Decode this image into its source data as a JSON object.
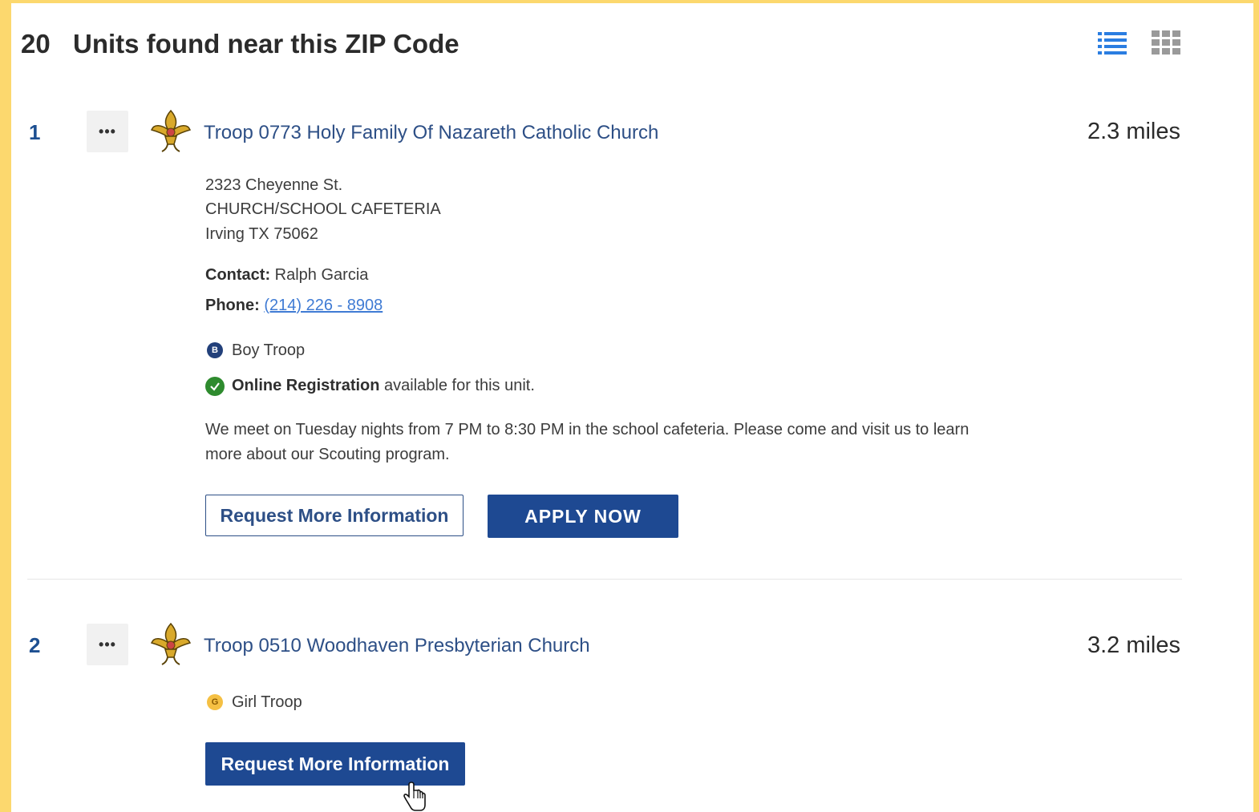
{
  "header": {
    "count": "20",
    "title": "Units found near this ZIP Code",
    "view_list_icon": "list-view-icon",
    "view_grid_icon": "grid-view-icon",
    "active_view": "list",
    "accent_color": "#2a7de1"
  },
  "units": [
    {
      "number": "1",
      "more_label": "•••",
      "name": "Troop 0773 Holy Family Of Nazareth Catholic Church",
      "distance": "2.3 miles",
      "address": [
        "2323 Cheyenne St.",
        "CHURCH/SCHOOL CAFETERIA",
        "Irving TX 75062"
      ],
      "contact_label": "Contact:",
      "contact_name": "Ralph Garcia",
      "phone_label": "Phone:",
      "phone": "(214) 226 - 8908",
      "type_badge": "B",
      "type": "Boy Troop",
      "registration_bold": "Online Registration",
      "registration_rest": "available for this unit.",
      "description": "We meet on Tuesday nights from 7 PM to 8:30 PM in the school cafeteria. Please come and visit us to learn more about our Scouting program.",
      "request_button": "Request More Information",
      "apply_button": "APPLY NOW"
    },
    {
      "number": "2",
      "more_label": "•••",
      "name": "Troop 0510 Woodhaven Presbyterian Church",
      "distance": "3.2 miles",
      "type_badge": "G",
      "type": "Girl Troop",
      "request_button": "Request More Information"
    }
  ],
  "colors": {
    "brand_blue": "#1e4992",
    "link_blue": "#3f7bd4",
    "success_green": "#2e8b2e",
    "frame_yellow": "#fcd86e"
  }
}
